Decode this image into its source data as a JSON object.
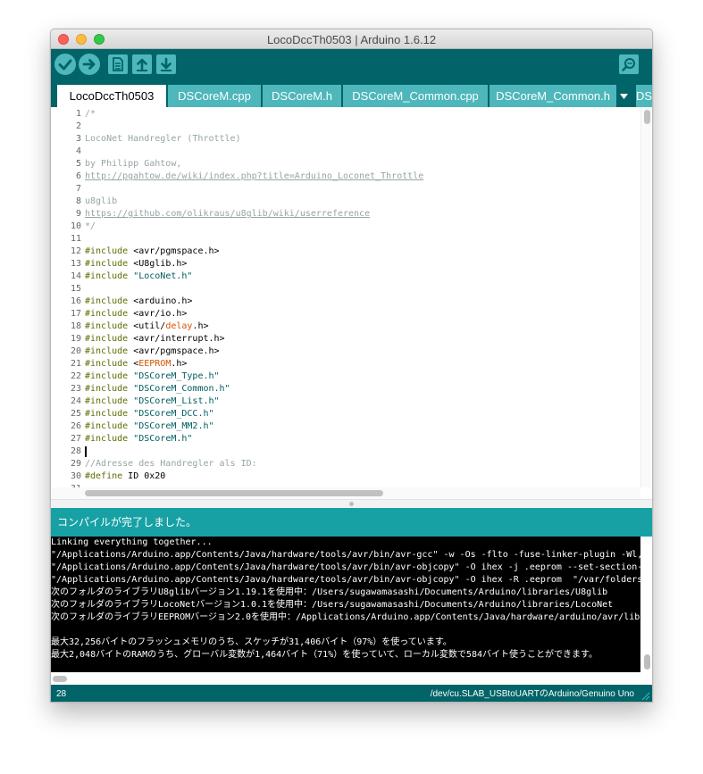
{
  "window": {
    "title": "LocoDccTh0503 | Arduino 1.6.12"
  },
  "toolbar": {
    "buttons": [
      {
        "name": "verify",
        "icon": "checkmark-icon"
      },
      {
        "name": "upload",
        "icon": "arrow-right-icon"
      },
      {
        "name": "new",
        "icon": "document-icon"
      },
      {
        "name": "open",
        "icon": "arrow-up-icon"
      },
      {
        "name": "save",
        "icon": "arrow-down-icon"
      },
      {
        "name": "serial-monitor",
        "icon": "magnifier-icon"
      }
    ]
  },
  "tabs": [
    {
      "label": "LocoDccTh0503",
      "active": true
    },
    {
      "label": "DSCoreM.cpp",
      "active": false
    },
    {
      "label": "DSCoreM.h",
      "active": false
    },
    {
      "label": "DSCoreM_Common.cpp",
      "active": false
    },
    {
      "label": "DSCoreM_Common.h",
      "active": false
    },
    {
      "label": "DSC",
      "active": false
    }
  ],
  "editor": {
    "lines": [
      {
        "n": "1",
        "t": "/*",
        "k": "c"
      },
      {
        "n": "2",
        "t": "",
        "k": "c"
      },
      {
        "n": "3",
        "t": "LocoNet Handregler (Throttle)",
        "k": "c"
      },
      {
        "n": "4",
        "t": "",
        "k": "c"
      },
      {
        "n": "5",
        "t": "by Philipp Gahtow,",
        "k": "c"
      },
      {
        "n": "6",
        "t": "http://pgahtow.de/wiki/index.php?title=Arduino_Loconet_Throttle",
        "k": "l"
      },
      {
        "n": "7",
        "t": "",
        "k": "c"
      },
      {
        "n": "8",
        "t": "u8glib",
        "k": "c"
      },
      {
        "n": "9",
        "t": "https://github.com/olikraus/u8glib/wiki/userreference",
        "k": "l"
      },
      {
        "n": "10",
        "t": "*/",
        "k": "c"
      },
      {
        "n": "11",
        "t": "",
        "k": "p"
      },
      {
        "n": "12",
        "kw": "#include",
        "rest": " <avr/pgmspace.h>",
        "k": "i"
      },
      {
        "n": "13",
        "kw": "#include",
        "rest": " <U8glib.h>",
        "k": "i"
      },
      {
        "n": "14",
        "kw": "#include",
        "rest": " \"LocoNet.h\"",
        "k": "is"
      },
      {
        "n": "15",
        "t": "",
        "k": "p"
      },
      {
        "n": "16",
        "kw": "#include",
        "rest": " <arduino.h>",
        "k": "i"
      },
      {
        "n": "17",
        "kw": "#include",
        "rest": " <avr/io.h>",
        "k": "i"
      },
      {
        "n": "18",
        "kw": "#include",
        "a": " <util/",
        "hl": "delay",
        "b": ".h>",
        "k": "ih"
      },
      {
        "n": "19",
        "kw": "#include",
        "rest": " <avr/interrupt.h>",
        "k": "i"
      },
      {
        "n": "20",
        "kw": "#include",
        "rest": " <avr/pgmspace.h>",
        "k": "i"
      },
      {
        "n": "21",
        "kw": "#include",
        "a": " <",
        "hl": "EEPROM",
        "b": ".h>",
        "k": "ih"
      },
      {
        "n": "22",
        "kw": "#include",
        "rest": " \"DSCoreM_Type.h\"",
        "k": "is"
      },
      {
        "n": "23",
        "kw": "#include",
        "rest": " \"DSCoreM_Common.h\"",
        "k": "is"
      },
      {
        "n": "24",
        "kw": "#include",
        "rest": " \"DSCoreM_List.h\"",
        "k": "is"
      },
      {
        "n": "25",
        "kw": "#include",
        "rest": " \"DSCoreM_DCC.h\"",
        "k": "is"
      },
      {
        "n": "26",
        "kw": "#include",
        "rest": " \"DSCoreM_MM2.h\"",
        "k": "is"
      },
      {
        "n": "27",
        "kw": "#include",
        "rest": " \"DSCoreM.h\"",
        "k": "is"
      },
      {
        "n": "28",
        "t": "",
        "k": "p"
      },
      {
        "n": "29",
        "t": "//Adresse des Handregler als ID:",
        "k": "c"
      },
      {
        "n": "30",
        "kw": "#define",
        "rest": " ID 0x20",
        "k": "i"
      },
      {
        "n": "31",
        "t": "",
        "k": "p"
      }
    ]
  },
  "status": {
    "message": "コンパイルが完了しました。"
  },
  "console": {
    "lines": [
      "Linking everything together...",
      "\"/Applications/Arduino.app/Contents/Java/hardware/tools/avr/bin/avr-gcc\" -w -Os -flto -fuse-linker-plugin -Wl,",
      "\"/Applications/Arduino.app/Contents/Java/hardware/tools/avr/bin/avr-objcopy\" -O ihex -j .eeprom --set-section-",
      "\"/Applications/Arduino.app/Contents/Java/hardware/tools/avr/bin/avr-objcopy\" -O ihex -R .eeprom  \"/var/folders",
      "次のフォルダのライブラリU8glibバージョン1.19.1を使用中：/Users/sugawamasashi/Documents/Arduino/libraries/U8glib",
      "次のフォルダのライブラリLocoNetバージョン1.0.1を使用中：/Users/sugawamasashi/Documents/Arduino/libraries/LocoNet",
      "次のフォルダのライブラリEEPROMバージョン2.0を使用中：/Applications/Arduino.app/Contents/Java/hardware/arduino/avr/libr",
      "",
      "最大32,256バイトのフラッシュメモリのうち、スケッチが31,406バイト（97%）を使っています。",
      "最大2,048バイトのRAMのうち、グローバル変数が1,464バイト（71%）を使っていて、ローカル変数で584バイト使うことができます。"
    ]
  },
  "footer": {
    "line_number": "28",
    "board": "/dev/cu.SLAB_USBtoUARTのArduino/Genuino Uno"
  },
  "colors": {
    "toolbar": "#006468",
    "tab_inactive": "#4db7bb",
    "status": "#17a1a5",
    "comment": "#95a5a6",
    "keyword": "#5e6d03",
    "string": "#005c5f",
    "highlight": "#d35400"
  }
}
